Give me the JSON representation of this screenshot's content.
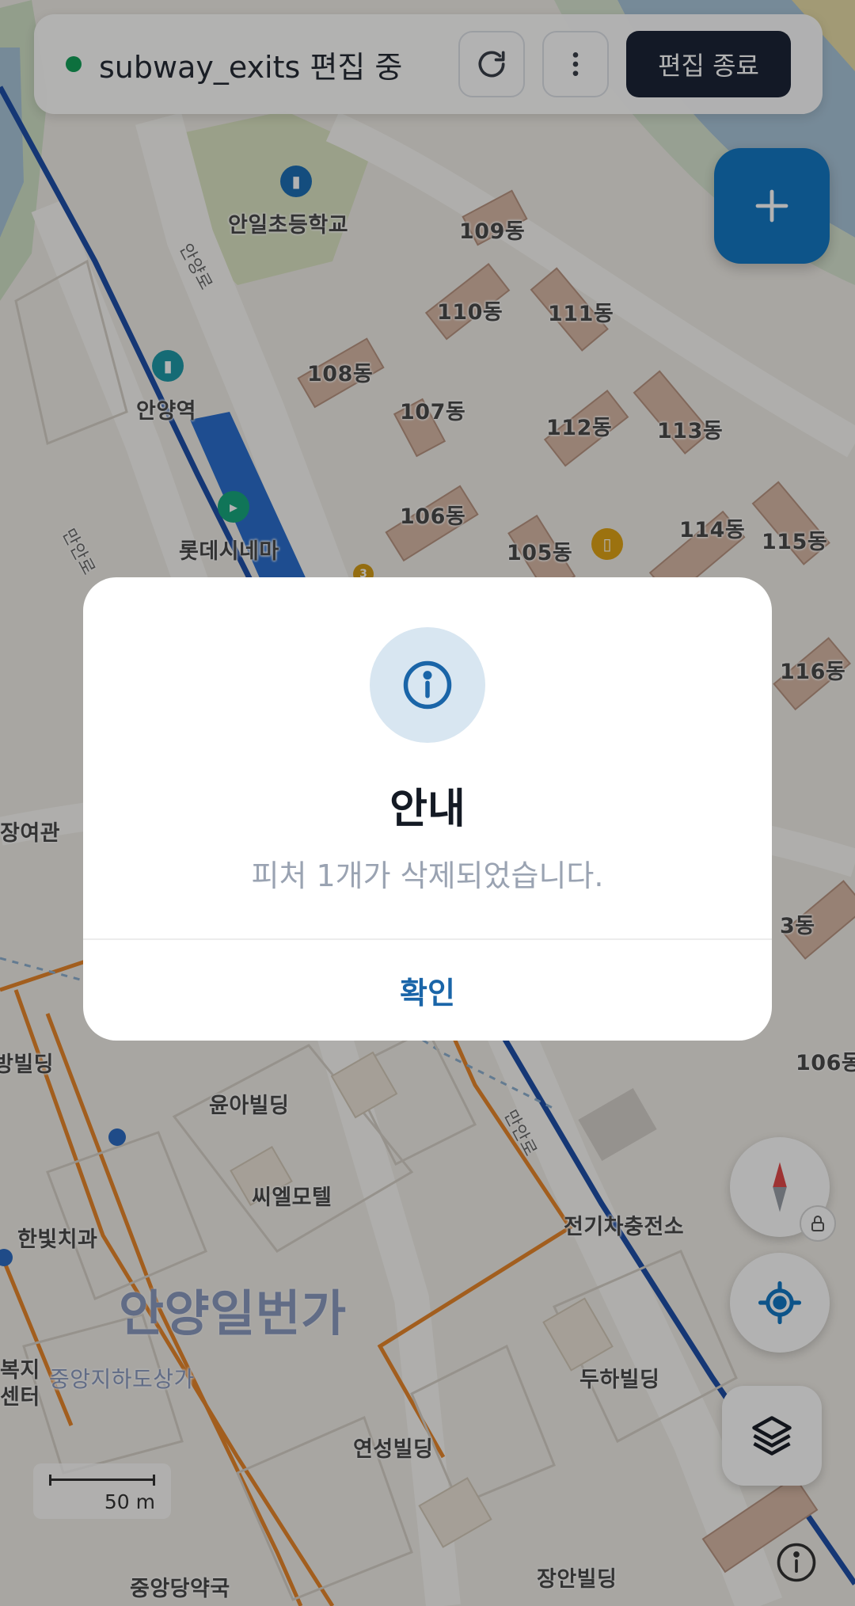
{
  "topbar": {
    "status_text": "subway_exits 편집 중",
    "status_color": "#14a15a",
    "refresh_icon": "refresh-icon",
    "more_icon": "more-vertical-icon",
    "end_edit_label": "편집 종료"
  },
  "map": {
    "labels": {
      "school": "안일초등학교",
      "bldg_109": "109동",
      "bldg_110": "110동",
      "bldg_111": "111동",
      "bldg_108": "108동",
      "bldg_107": "107동",
      "bldg_112": "112동",
      "bldg_113": "113동",
      "station": "안양역",
      "bldg_106": "106동",
      "bldg_105": "105동",
      "bldg_114": "114동",
      "bldg_115": "115동",
      "cinema": "롯데시네마",
      "bldg_116": "116동",
      "hall": "장여관",
      "bldg_103": "3동",
      "bldg_106b": "106동",
      "bldg_left": "방빌딩",
      "yuna": "윤아빌딩",
      "motel": "씨엘모텔",
      "ev_charge": "전기차충전소",
      "dental": "한빛치과",
      "district": "안양일번가",
      "welfare_1": "복지",
      "welfare_2": "센터",
      "underground": "중앙지하도상가",
      "duha": "두하빌딩",
      "yeonseong": "연성빌딩",
      "pharmacy": "중앙당약국",
      "jangan": "장안빌딩",
      "road_1": "안양로",
      "road_2": "만안로",
      "road_3": "만안로"
    },
    "scale_label": "50 m"
  },
  "controls": {
    "add_icon": "plus-icon",
    "compass_icon": "compass-icon",
    "lock_icon": "lock-icon",
    "locate_icon": "locate-icon",
    "layers_icon": "layers-icon",
    "attribution_icon": "info-icon"
  },
  "dialog": {
    "icon": "info-icon",
    "title": "안내",
    "message": "피처 1개가 삭제되었습니다.",
    "confirm_label": "확인"
  },
  "colors": {
    "primary": "#1479c5",
    "dark": "#1c2537",
    "link": "#1a65a8"
  }
}
